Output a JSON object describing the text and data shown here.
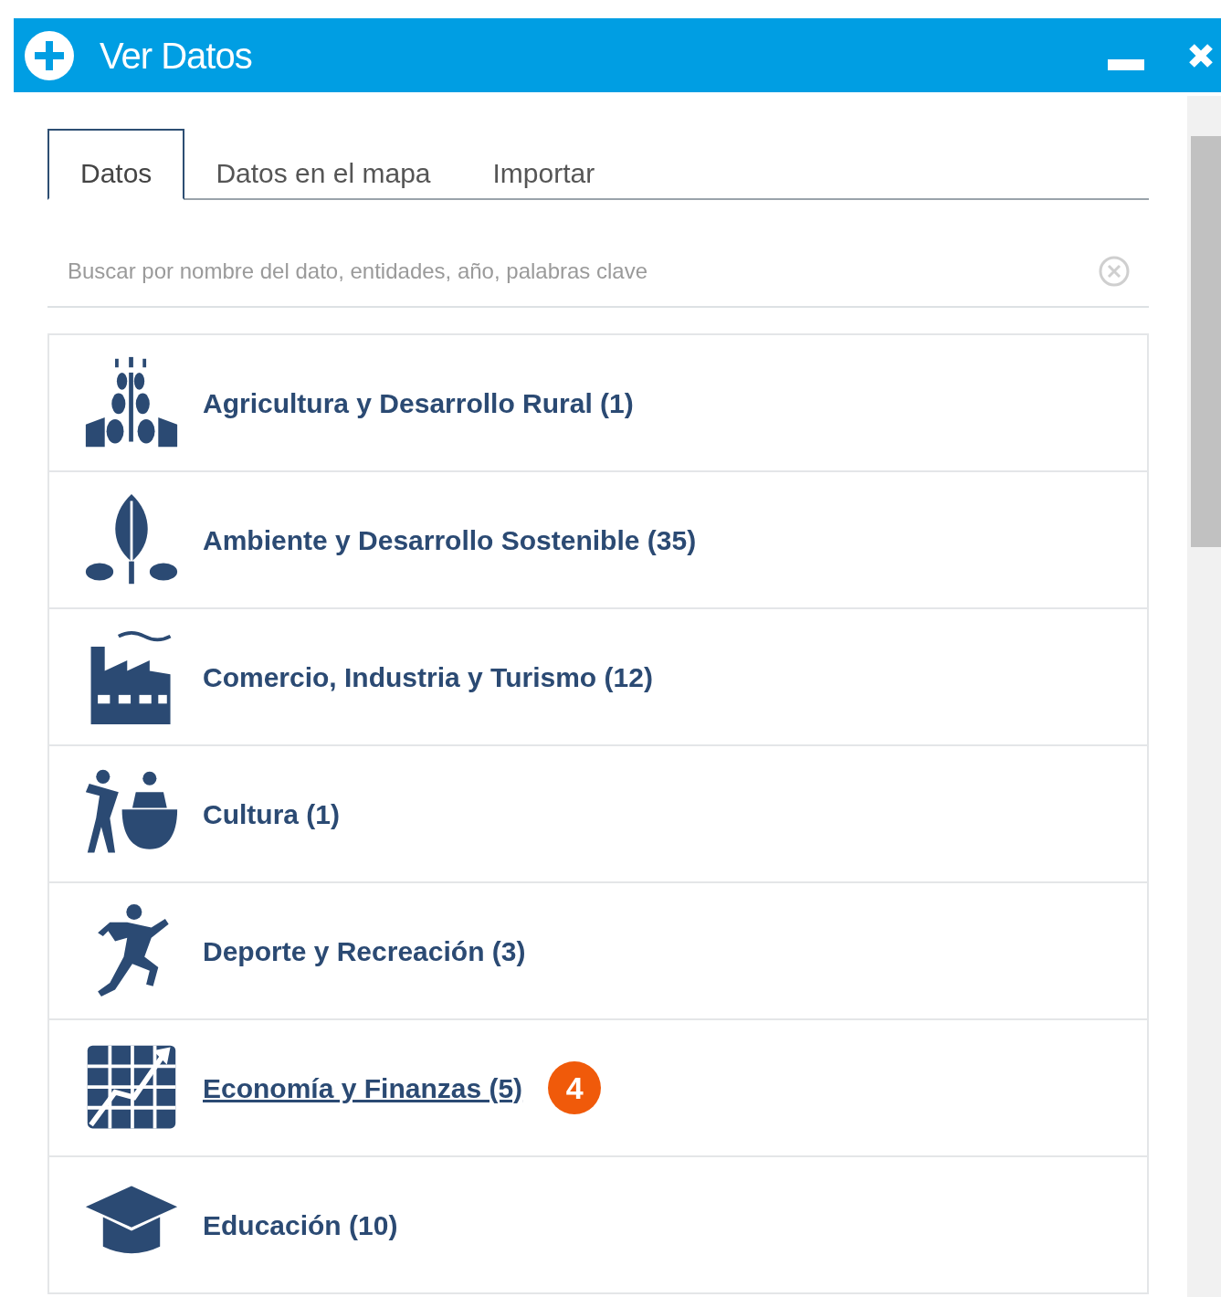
{
  "window": {
    "title": "Ver Datos"
  },
  "tabs": [
    {
      "label": "Datos",
      "selected": true
    },
    {
      "label": "Datos en el mapa",
      "selected": false
    },
    {
      "label": "Importar",
      "selected": false
    }
  ],
  "search": {
    "placeholder": "Buscar por nombre del dato, entidades, año, palabras clave"
  },
  "categories": [
    {
      "label": "Agricultura y Desarrollo Rural (1)",
      "hovered": false
    },
    {
      "label": "Ambiente y Desarrollo Sostenible (35)",
      "hovered": false
    },
    {
      "label": "Comercio, Industria y Turismo (12)",
      "hovered": false
    },
    {
      "label": "Cultura (1)",
      "hovered": false
    },
    {
      "label": "Deporte y Recreación (3)",
      "hovered": false
    },
    {
      "label": "Economía y Finanzas (5)",
      "hovered": true,
      "marker": "4"
    },
    {
      "label": "Educación (10)",
      "hovered": false
    }
  ]
}
